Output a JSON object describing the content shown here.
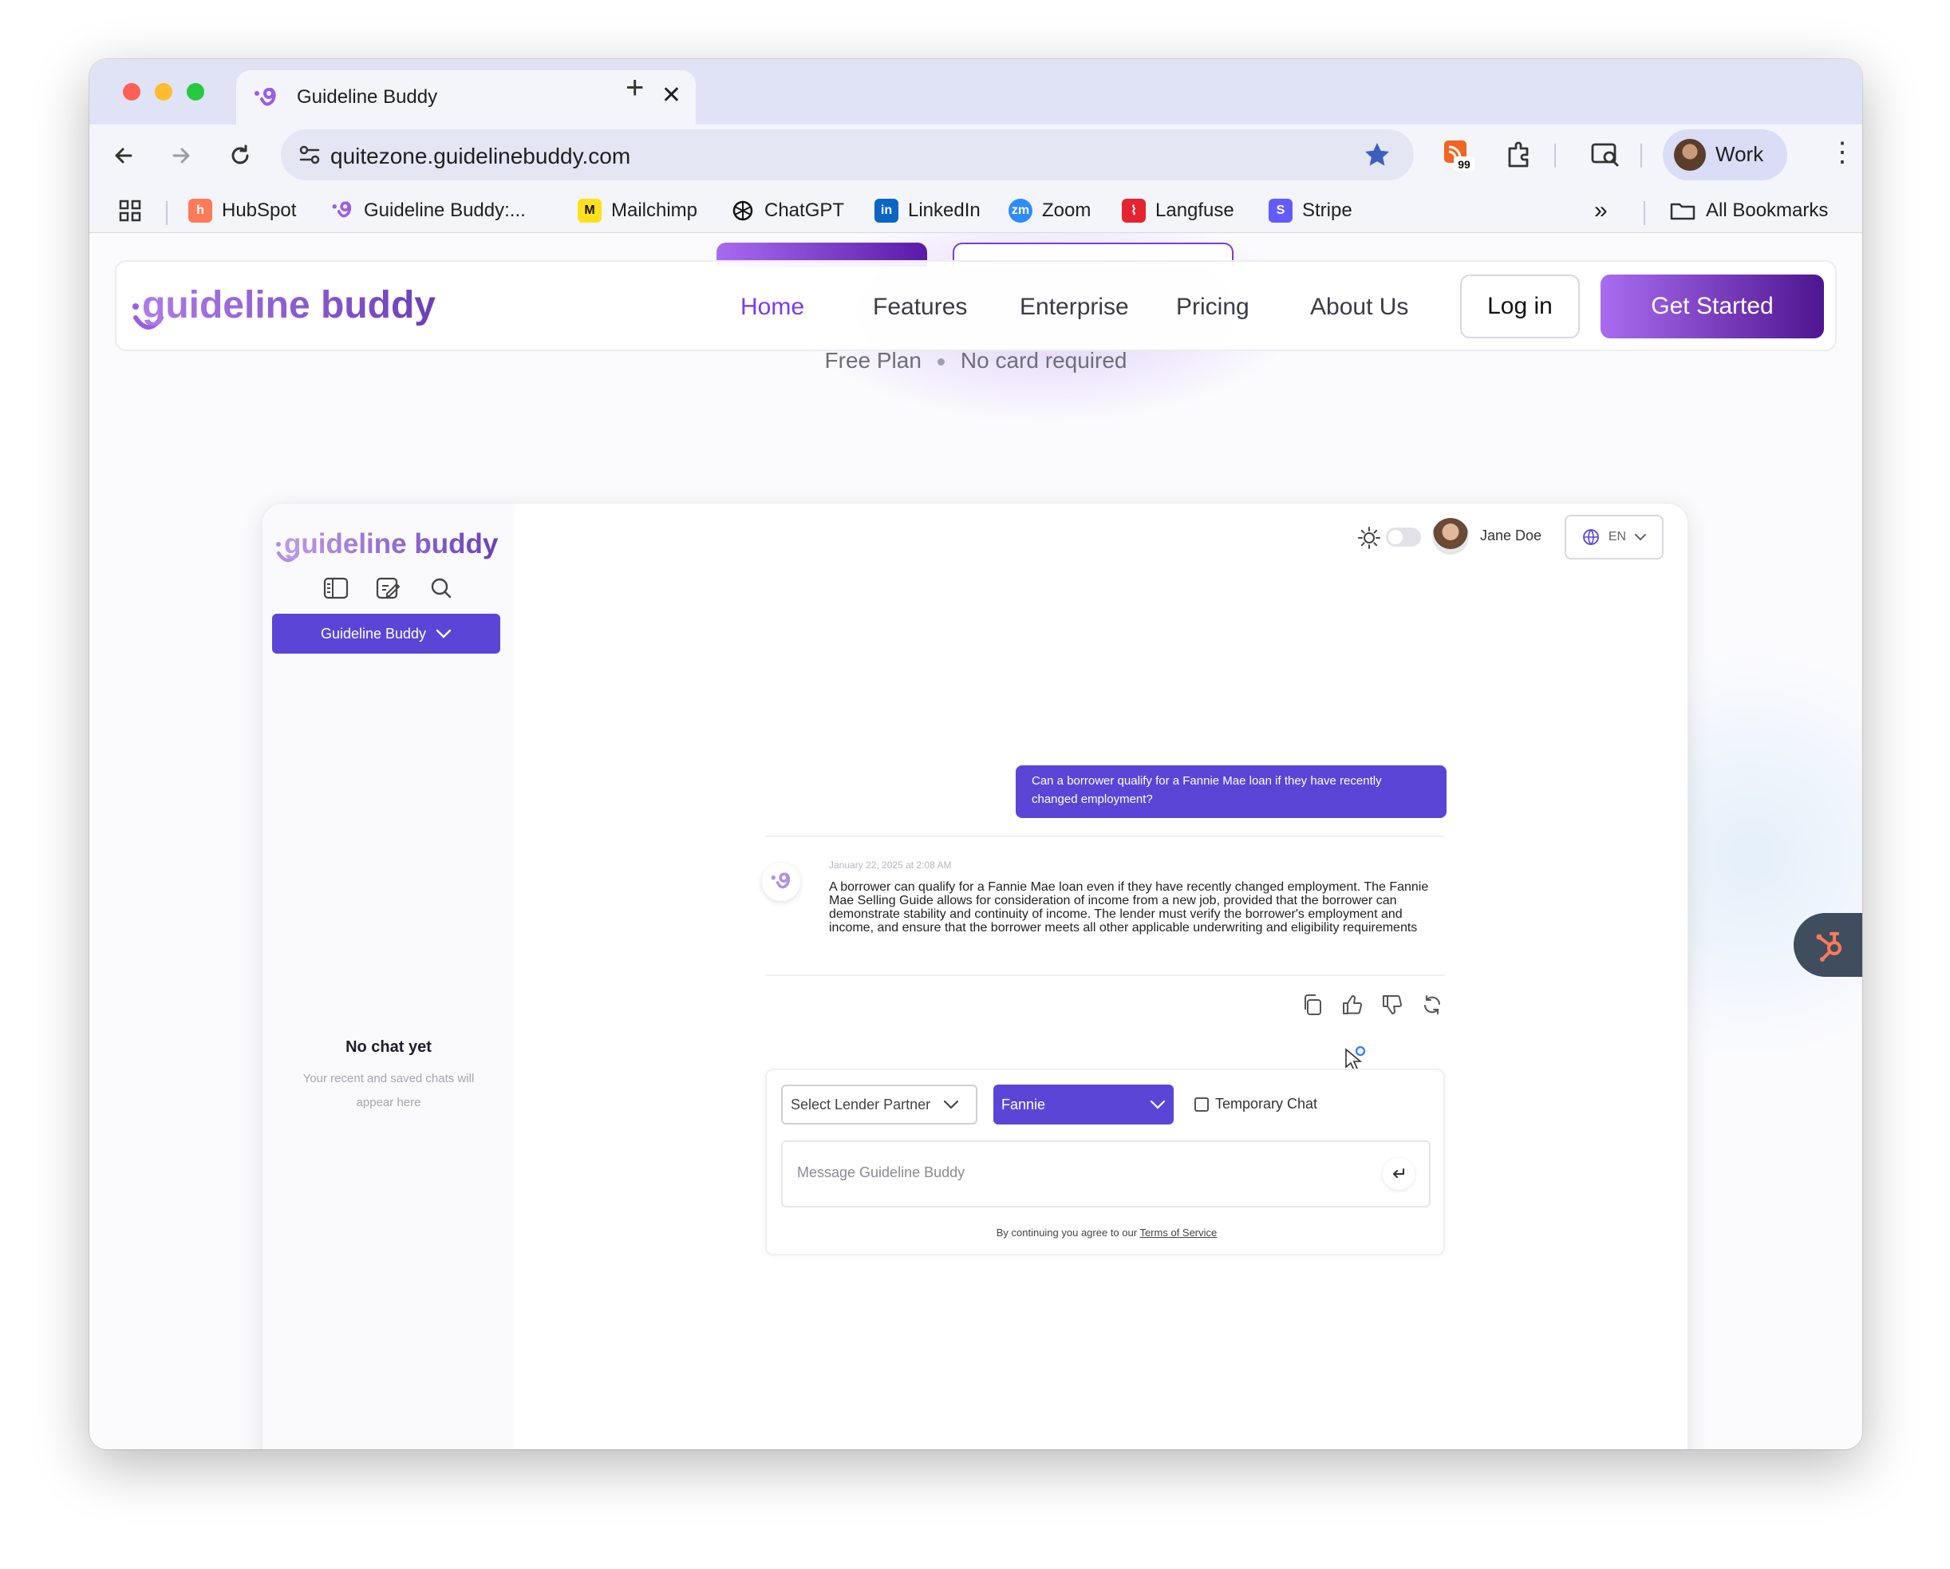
{
  "browser": {
    "tab_title": "Guideline Buddy",
    "tab_close": "✕",
    "new_tab": "+",
    "url": "quitezone.guidelinebuddy.com",
    "extension_badge": "99",
    "profile_label": "Work",
    "menu_glyph": "⋮"
  },
  "bookmarks": [
    {
      "label": "HubSpot",
      "color": "#ff7a59"
    },
    {
      "label": "Guideline Buddy:...",
      "color": "#9b5de5"
    },
    {
      "label": "Mailchimp",
      "color": "#ffe01b"
    },
    {
      "label": "ChatGPT",
      "color": "#111111"
    },
    {
      "label": "LinkedIn",
      "color": "#0a66c2"
    },
    {
      "label": "Zoom",
      "color": "#2d8cff"
    },
    {
      "label": "Langfuse",
      "color": "#e4252f"
    },
    {
      "label": "Stripe",
      "color": "#635bff"
    }
  ],
  "bookmarks_more": "»",
  "bookmarks_all": "All Bookmarks",
  "site": {
    "logo_text": "guideline buddy",
    "nav": [
      "Home",
      "Features",
      "Enterprise",
      "Pricing",
      "About Us"
    ],
    "login": "Log in",
    "get_started": "Get Started",
    "badges": [
      "Free Plan",
      "No card required"
    ],
    "accent": "#7c3aed"
  },
  "mock": {
    "logo_text": "guideline buddy",
    "model_select": "Guideline Buddy",
    "no_chat_title": "No chat yet",
    "no_chat_text": "Your recent and saved chats will appear here",
    "user_name": "Jane Doe",
    "language": "EN",
    "user_message": "Can a borrower qualify for a Fannie Mae loan if they have recently changed employment?",
    "bot_timestamp": "January 22, 2025 at 2:08 AM",
    "bot_message": "A borrower can qualify for a Fannie Mae loan even if they have recently changed employment. The Fannie Mae Selling Guide allows for consideration of income from a new job, provided that the borrower can demonstrate stability and continuity of income. The lender must verify the borrower's employment and income, and ensure that the borrower meets all other applicable underwriting and eligibility requirements",
    "lender_select": "Select Lender Partner",
    "investor_select": "Fannie",
    "temporary_chat": "Temporary Chat",
    "input_placeholder": "Message Guideline Buddy",
    "tos_prefix": "By continuing you agree to our",
    "tos_link": "Terms of Service",
    "accent": "#5b45d6"
  }
}
